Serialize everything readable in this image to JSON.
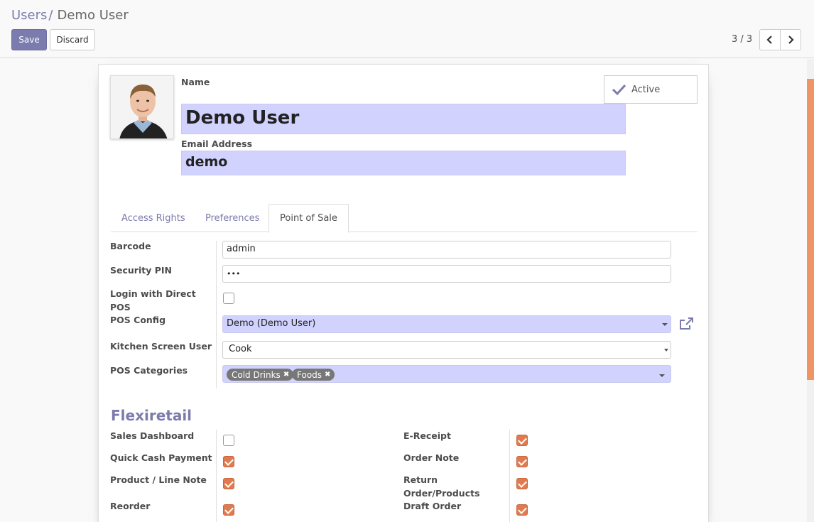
{
  "breadcrumb": {
    "parent": "Users",
    "separator": "/",
    "current": "Demo User"
  },
  "toolbar": {
    "save_label": "Save",
    "discard_label": "Discard"
  },
  "pager": {
    "value": "3 / 3"
  },
  "user": {
    "name_label": "Name",
    "name": "Demo User",
    "email_label": "Email Address",
    "email": "demo",
    "active_label": "Active"
  },
  "tabs": [
    {
      "label": "Access Rights",
      "active": false
    },
    {
      "label": "Preferences",
      "active": false
    },
    {
      "label": "Point of Sale",
      "active": true
    }
  ],
  "pos": {
    "barcode": {
      "label": "Barcode",
      "value": "admin"
    },
    "security_pin": {
      "label": "Security PIN",
      "value": "•••"
    },
    "login_direct": {
      "label_line1": "Login with Direct",
      "label_line2": "POS",
      "checked": false
    },
    "pos_config": {
      "label": "POS Config",
      "value": "Demo (Demo User)"
    },
    "kitchen_user": {
      "label": "Kitchen Screen User",
      "value": "Cook"
    },
    "categories": {
      "label": "POS Categories",
      "tags": [
        "Cold Drinks",
        "Foods"
      ]
    }
  },
  "flexiretail": {
    "title": "Flexiretail",
    "left": [
      {
        "label": "Sales Dashboard",
        "checked": false
      },
      {
        "label": "Quick Cash Payment",
        "checked": true
      },
      {
        "label": "Product / Line Note",
        "checked": true
      },
      {
        "label": "Reorder",
        "checked": true
      }
    ],
    "right": [
      {
        "label": "E-Receipt",
        "checked": true
      },
      {
        "label": "Order Note",
        "checked": true
      },
      {
        "label_line1": "Return",
        "label_line2": "Order/Products",
        "checked": true
      },
      {
        "label": "Draft Order",
        "checked": true
      }
    ]
  },
  "colors": {
    "accent": "#7c7bad",
    "required_bg": "#d2d2ff",
    "checkbox_checked": "#e07b4f",
    "scroll_thumb": "#ef9565"
  }
}
